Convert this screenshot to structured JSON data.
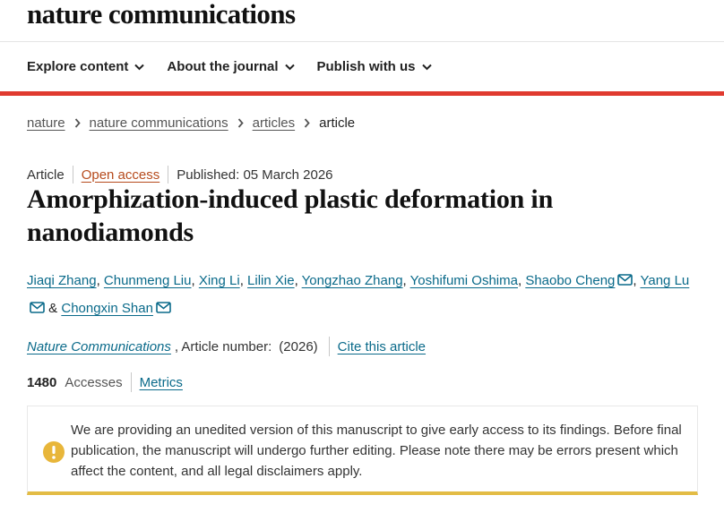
{
  "header": {
    "logo": "nature communications"
  },
  "nav": {
    "items": [
      {
        "label": "Explore content"
      },
      {
        "label": "About the journal"
      },
      {
        "label": "Publish with us"
      }
    ]
  },
  "breadcrumb": {
    "items": [
      "nature",
      "nature communications",
      "articles"
    ],
    "current": "article"
  },
  "article": {
    "type": "Article",
    "access": "Open access",
    "published": "Published: 05 March 2026",
    "title": "Amorphization-induced plastic deformation in nanodiamonds",
    "authors": [
      "Jiaqi Zhang",
      "Chunmeng Liu",
      "Xing Li",
      "Lilin Xie",
      "Yongzhao Zhang",
      "Yoshifumi Oshima",
      "Shaobo Cheng",
      "Yang Lu",
      "Chongxin Shan"
    ],
    "author_sep": ",",
    "author_amp": "&",
    "journal": "Nature Communications",
    "article_number_label": ", Article number:",
    "article_number_value": "(2026)",
    "cite": "Cite this article",
    "accesses_count": "1480",
    "accesses_label": "Accesses",
    "metrics": "Metrics"
  },
  "notice": {
    "icon": "warning-circle-icon",
    "text": "We are providing an unedited version of this manuscript to give early access to its findings. Before final publication, the manuscript will undergo further editing. Please note there may be errors present which affect the content, and all legal disclaimers apply."
  },
  "colors": {
    "accent_red": "#e03a2f",
    "link": "#0a6a8a",
    "open_access": "#b64b1d",
    "notice_border": "#e3bc45"
  }
}
